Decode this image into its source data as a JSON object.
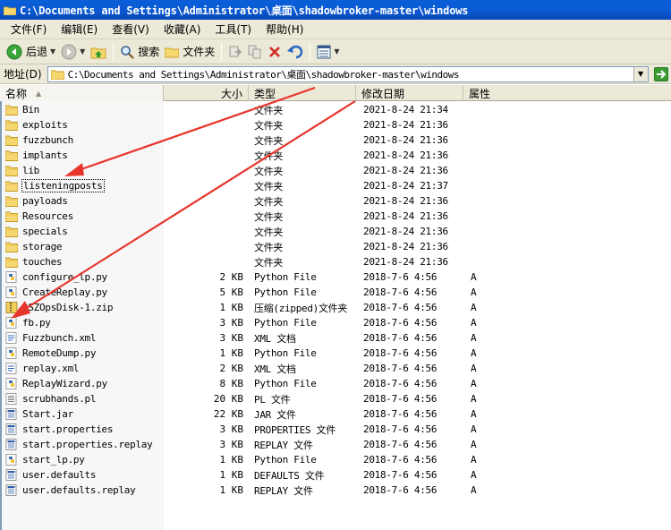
{
  "window": {
    "title": "C:\\Documents and Settings\\Administrator\\桌面\\shadowbroker-master\\windows"
  },
  "menu": [
    {
      "label": "文件(F)"
    },
    {
      "label": "编辑(E)"
    },
    {
      "label": "查看(V)"
    },
    {
      "label": "收藏(A)"
    },
    {
      "label": "工具(T)"
    },
    {
      "label": "帮助(H)"
    }
  ],
  "toolbar": {
    "back_label": "后退",
    "search_label": "搜索",
    "folders_label": "文件夹"
  },
  "address": {
    "label": "地址(D)",
    "value": "C:\\Documents and Settings\\Administrator\\桌面\\shadowbroker-master\\windows"
  },
  "columns": {
    "name": "名称",
    "size": "大小",
    "type": "类型",
    "modified": "修改日期",
    "attributes": "属性"
  },
  "files": [
    {
      "name": "Bin",
      "size": "",
      "type": "文件夹",
      "date": "2021-8-24 21:34",
      "attr": "",
      "icon": "folder-icon"
    },
    {
      "name": "exploits",
      "size": "",
      "type": "文件夹",
      "date": "2021-8-24 21:36",
      "attr": "",
      "icon": "folder-icon"
    },
    {
      "name": "fuzzbunch",
      "size": "",
      "type": "文件夹",
      "date": "2021-8-24 21:36",
      "attr": "",
      "icon": "folder-icon"
    },
    {
      "name": "implants",
      "size": "",
      "type": "文件夹",
      "date": "2021-8-24 21:36",
      "attr": "",
      "icon": "folder-icon"
    },
    {
      "name": "lib",
      "size": "",
      "type": "文件夹",
      "date": "2021-8-24 21:36",
      "attr": "",
      "icon": "folder-icon"
    },
    {
      "name": "listeningposts",
      "size": "",
      "type": "文件夹",
      "date": "2021-8-24 21:37",
      "attr": "",
      "icon": "folder-icon"
    },
    {
      "name": "payloads",
      "size": "",
      "type": "文件夹",
      "date": "2021-8-24 21:36",
      "attr": "",
      "icon": "folder-icon"
    },
    {
      "name": "Resources",
      "size": "",
      "type": "文件夹",
      "date": "2021-8-24 21:36",
      "attr": "",
      "icon": "folder-icon"
    },
    {
      "name": "specials",
      "size": "",
      "type": "文件夹",
      "date": "2021-8-24 21:36",
      "attr": "",
      "icon": "folder-icon"
    },
    {
      "name": "storage",
      "size": "",
      "type": "文件夹",
      "date": "2021-8-24 21:36",
      "attr": "",
      "icon": "folder-icon"
    },
    {
      "name": "touches",
      "size": "",
      "type": "文件夹",
      "date": "2021-8-24 21:36",
      "attr": "",
      "icon": "folder-icon"
    },
    {
      "name": "configure_lp.py",
      "size": "2 KB",
      "type": "Python File",
      "date": "2018-7-6 4:56",
      "attr": "A",
      "icon": "python-file-icon"
    },
    {
      "name": "CreateReplay.py",
      "size": "5 KB",
      "type": "Python File",
      "date": "2018-7-6 4:56",
      "attr": "A",
      "icon": "python-file-icon"
    },
    {
      "name": "DSZOpsDisk-1.zip",
      "size": "1 KB",
      "type": "压缩(zipped)文件夹",
      "date": "2018-7-6 4:56",
      "attr": "A",
      "icon": "zip-icon"
    },
    {
      "name": "fb.py",
      "size": "3 KB",
      "type": "Python File",
      "date": "2018-7-6 4:56",
      "attr": "A",
      "icon": "python-file-icon"
    },
    {
      "name": "Fuzzbunch.xml",
      "size": "3 KB",
      "type": "XML 文档",
      "date": "2018-7-6 4:56",
      "attr": "A",
      "icon": "xml-file-icon"
    },
    {
      "name": "RemoteDump.py",
      "size": "1 KB",
      "type": "Python File",
      "date": "2018-7-6 4:56",
      "attr": "A",
      "icon": "python-file-icon"
    },
    {
      "name": "replay.xml",
      "size": "2 KB",
      "type": "XML 文档",
      "date": "2018-7-6 4:56",
      "attr": "A",
      "icon": "xml-file-icon"
    },
    {
      "name": "ReplayWizard.py",
      "size": "8 KB",
      "type": "Python File",
      "date": "2018-7-6 4:56",
      "attr": "A",
      "icon": "python-file-icon"
    },
    {
      "name": "scrubhands.pl",
      "size": "20 KB",
      "type": "PL 文件",
      "date": "2018-7-6 4:56",
      "attr": "A",
      "icon": "text-file-icon"
    },
    {
      "name": "Start.jar",
      "size": "22 KB",
      "type": "JAR 文件",
      "date": "2018-7-6 4:56",
      "attr": "A",
      "icon": "generic-file-icon"
    },
    {
      "name": "start.properties",
      "size": "3 KB",
      "type": "PROPERTIES 文件",
      "date": "2018-7-6 4:56",
      "attr": "A",
      "icon": "generic-file-icon"
    },
    {
      "name": "start.properties.replay",
      "size": "3 KB",
      "type": "REPLAY 文件",
      "date": "2018-7-6 4:56",
      "attr": "A",
      "icon": "generic-file-icon"
    },
    {
      "name": "start_lp.py",
      "size": "1 KB",
      "type": "Python File",
      "date": "2018-7-6 4:56",
      "attr": "A",
      "icon": "python-file-icon"
    },
    {
      "name": "user.defaults",
      "size": "1 KB",
      "type": "DEFAULTS 文件",
      "date": "2018-7-6 4:56",
      "attr": "A",
      "icon": "generic-file-icon"
    },
    {
      "name": "user.defaults.replay",
      "size": "1 KB",
      "type": "REPLAY 文件",
      "date": "2018-7-6 4:56",
      "attr": "A",
      "icon": "generic-file-icon"
    }
  ],
  "focused_file": "listeningposts",
  "colors": {
    "titlebar": "#0a5fd8",
    "chrome": "#ece9d8",
    "annotation_arrow": "#e8352c"
  }
}
